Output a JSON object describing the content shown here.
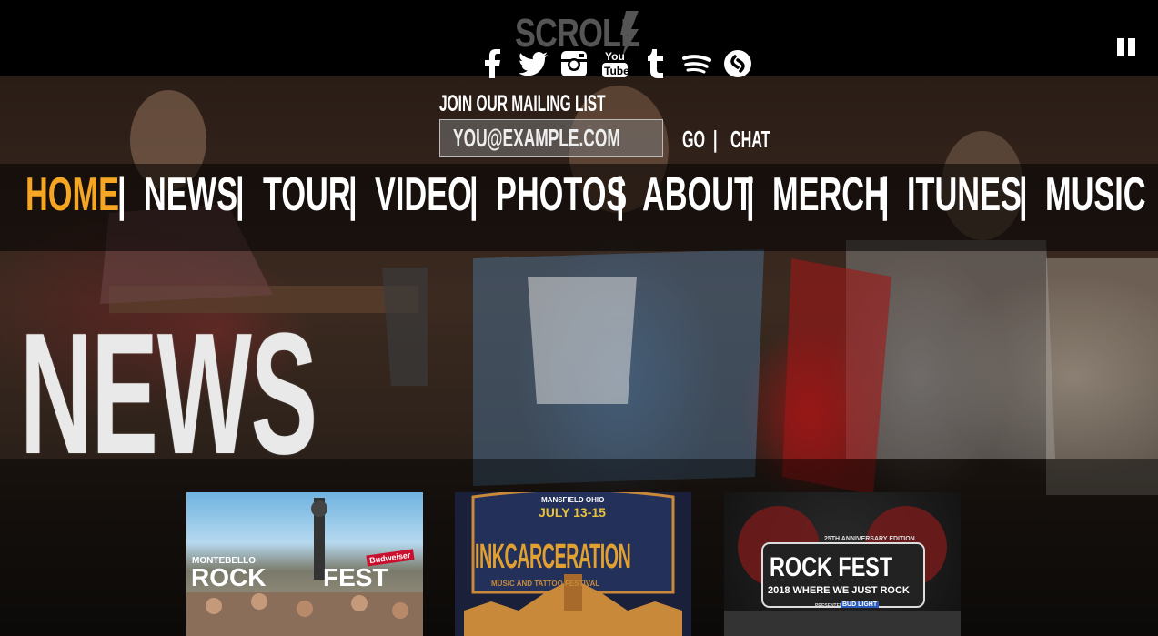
{
  "brand": {
    "logo_text": "SCROLL"
  },
  "social": [
    {
      "icon": "facebook-icon",
      "glyph": "f"
    },
    {
      "icon": "twitter-icon",
      "glyph": ""
    },
    {
      "icon": "instagram-icon",
      "glyph": ""
    },
    {
      "icon": "youtube-icon",
      "glyph": "You Tube"
    },
    {
      "icon": "tumblr-icon",
      "glyph": "t"
    },
    {
      "icon": "spotify-icon",
      "glyph": ""
    },
    {
      "icon": "shazam-icon",
      "glyph": ""
    }
  ],
  "mailing": {
    "label": "JOIN OUR MAILING LIST",
    "placeholder": "YOU@EXAMPLE.COM",
    "go_label": "GO",
    "separator": "|",
    "chat_label": "CHAT"
  },
  "nav": {
    "separator": "|",
    "items": [
      "HOME",
      "NEWS",
      "TOUR",
      "VIDEO",
      "PHOTOS",
      "ABOUT",
      "MERCH",
      "ITUNES",
      "MUSIC"
    ],
    "active": "HOME",
    "active_color": "#f5a623"
  },
  "page": {
    "title": "NEWS"
  },
  "cards": [
    {
      "line1": "MONTEBELLO",
      "line2": "ROCK",
      "line3": "FEST",
      "badge": "Budweiser"
    },
    {
      "line1": "MANSFIELD OHIO",
      "line2": "JULY 13-15",
      "line3": "INKCARCERATION",
      "line4": "MUSIC AND TATTOO FESTIVAL"
    },
    {
      "line1": "25TH ANNIVERSARY EDITION",
      "line2": "ROCK FEST",
      "line3": "2018 WHERE WE JUST ROCK",
      "line4": "PRESENTED BY",
      "badge": "BUD LIGHT"
    }
  ]
}
